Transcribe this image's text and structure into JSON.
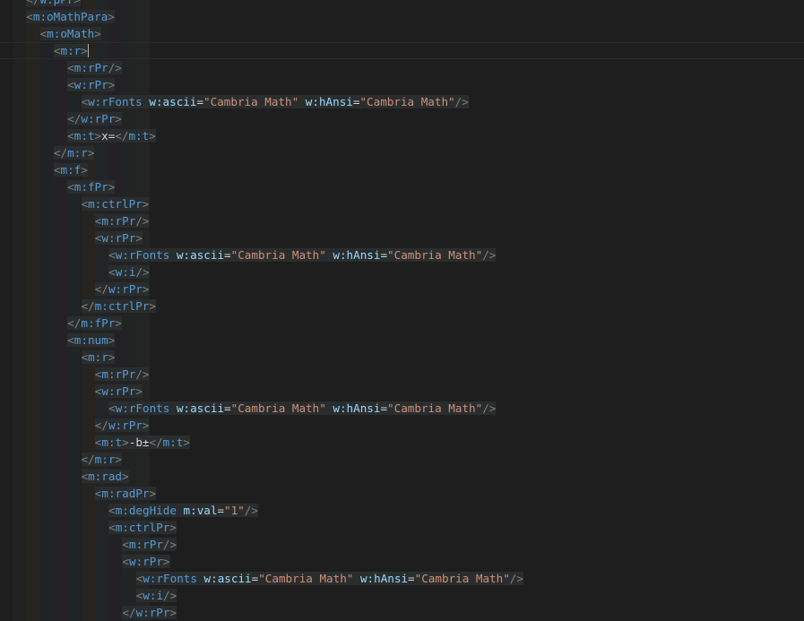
{
  "editor": {
    "theme_colors": {
      "background": "#1e1e1e",
      "tag": "#569cd6",
      "attribute": "#9cdcfe",
      "value": "#ce9178",
      "text": "#d4d4d4",
      "bracket": "#808080"
    },
    "lines": [
      {
        "indent": 1,
        "parts": [
          {
            "t": "b",
            "v": "</"
          },
          {
            "t": "tag",
            "v": "w:pPr"
          },
          {
            "t": "b",
            "v": ">"
          }
        ]
      },
      {
        "indent": 1,
        "parts": [
          {
            "t": "b",
            "v": "<"
          },
          {
            "t": "tag",
            "v": "m:oMathPara"
          },
          {
            "t": "b",
            "v": ">"
          }
        ]
      },
      {
        "indent": 2,
        "parts": [
          {
            "t": "b",
            "v": "<"
          },
          {
            "t": "tag",
            "v": "m:oMath"
          },
          {
            "t": "b",
            "v": ">"
          }
        ]
      },
      {
        "indent": 3,
        "current": true,
        "caret": true,
        "parts": [
          {
            "t": "b",
            "v": "<"
          },
          {
            "t": "tag",
            "v": "m:r"
          },
          {
            "t": "b",
            "v": ">"
          }
        ]
      },
      {
        "indent": 4,
        "parts": [
          {
            "t": "b",
            "v": "<"
          },
          {
            "t": "tag",
            "v": "m:rPr"
          },
          {
            "t": "b",
            "v": "/>"
          }
        ]
      },
      {
        "indent": 4,
        "parts": [
          {
            "t": "b",
            "v": "<"
          },
          {
            "t": "tag",
            "v": "w:rPr"
          },
          {
            "t": "b",
            "v": ">"
          }
        ]
      },
      {
        "indent": 5,
        "parts": [
          {
            "t": "b",
            "v": "<"
          },
          {
            "t": "tag",
            "v": "w:rFonts"
          },
          {
            "t": "s",
            "v": " "
          },
          {
            "t": "attr",
            "v": "w:ascii"
          },
          {
            "t": "eq",
            "v": "="
          },
          {
            "t": "val",
            "v": "\"Cambria Math\""
          },
          {
            "t": "s",
            "v": " "
          },
          {
            "t": "attr",
            "v": "w:hAnsi"
          },
          {
            "t": "eq",
            "v": "="
          },
          {
            "t": "val",
            "v": "\"Cambria Math\""
          },
          {
            "t": "b",
            "v": "/>"
          }
        ]
      },
      {
        "indent": 4,
        "parts": [
          {
            "t": "b",
            "v": "</"
          },
          {
            "t": "tag",
            "v": "w:rPr"
          },
          {
            "t": "b",
            "v": ">"
          }
        ]
      },
      {
        "indent": 4,
        "parts": [
          {
            "t": "b",
            "v": "<"
          },
          {
            "t": "tag",
            "v": "m:t"
          },
          {
            "t": "b",
            "v": ">"
          },
          {
            "t": "text",
            "v": "x="
          },
          {
            "t": "b",
            "v": "</"
          },
          {
            "t": "tag",
            "v": "m:t"
          },
          {
            "t": "b",
            "v": ">"
          }
        ]
      },
      {
        "indent": 3,
        "parts": [
          {
            "t": "b",
            "v": "</"
          },
          {
            "t": "tag",
            "v": "m:r"
          },
          {
            "t": "b",
            "v": ">"
          }
        ]
      },
      {
        "indent": 3,
        "parts": [
          {
            "t": "b",
            "v": "<"
          },
          {
            "t": "tag",
            "v": "m:f"
          },
          {
            "t": "b",
            "v": ">"
          }
        ]
      },
      {
        "indent": 4,
        "parts": [
          {
            "t": "b",
            "v": "<"
          },
          {
            "t": "tag",
            "v": "m:fPr"
          },
          {
            "t": "b",
            "v": ">"
          }
        ]
      },
      {
        "indent": 5,
        "parts": [
          {
            "t": "b",
            "v": "<"
          },
          {
            "t": "tag",
            "v": "m:ctrlPr"
          },
          {
            "t": "b",
            "v": ">"
          }
        ]
      },
      {
        "indent": 6,
        "parts": [
          {
            "t": "b",
            "v": "<"
          },
          {
            "t": "tag",
            "v": "m:rPr"
          },
          {
            "t": "b",
            "v": "/>"
          }
        ]
      },
      {
        "indent": 6,
        "parts": [
          {
            "t": "b",
            "v": "<"
          },
          {
            "t": "tag",
            "v": "w:rPr"
          },
          {
            "t": "b",
            "v": ">"
          }
        ]
      },
      {
        "indent": 7,
        "parts": [
          {
            "t": "b",
            "v": "<"
          },
          {
            "t": "tag",
            "v": "w:rFonts"
          },
          {
            "t": "s",
            "v": " "
          },
          {
            "t": "attr",
            "v": "w:ascii"
          },
          {
            "t": "eq",
            "v": "="
          },
          {
            "t": "val",
            "v": "\"Cambria Math\""
          },
          {
            "t": "s",
            "v": " "
          },
          {
            "t": "attr",
            "v": "w:hAnsi"
          },
          {
            "t": "eq",
            "v": "="
          },
          {
            "t": "val",
            "v": "\"Cambria Math\""
          },
          {
            "t": "b",
            "v": "/>"
          }
        ]
      },
      {
        "indent": 7,
        "parts": [
          {
            "t": "b",
            "v": "<"
          },
          {
            "t": "tag",
            "v": "w:i"
          },
          {
            "t": "b",
            "v": "/>"
          }
        ]
      },
      {
        "indent": 6,
        "parts": [
          {
            "t": "b",
            "v": "</"
          },
          {
            "t": "tag",
            "v": "w:rPr"
          },
          {
            "t": "b",
            "v": ">"
          }
        ]
      },
      {
        "indent": 5,
        "parts": [
          {
            "t": "b",
            "v": "</"
          },
          {
            "t": "tag",
            "v": "m:ctrlPr"
          },
          {
            "t": "b",
            "v": ">"
          }
        ]
      },
      {
        "indent": 4,
        "parts": [
          {
            "t": "b",
            "v": "</"
          },
          {
            "t": "tag",
            "v": "m:fPr"
          },
          {
            "t": "b",
            "v": ">"
          }
        ]
      },
      {
        "indent": 4,
        "parts": [
          {
            "t": "b",
            "v": "<"
          },
          {
            "t": "tag",
            "v": "m:num"
          },
          {
            "t": "b",
            "v": ">"
          }
        ]
      },
      {
        "indent": 5,
        "parts": [
          {
            "t": "b",
            "v": "<"
          },
          {
            "t": "tag",
            "v": "m:r"
          },
          {
            "t": "b",
            "v": ">"
          }
        ]
      },
      {
        "indent": 6,
        "parts": [
          {
            "t": "b",
            "v": "<"
          },
          {
            "t": "tag",
            "v": "m:rPr"
          },
          {
            "t": "b",
            "v": "/>"
          }
        ]
      },
      {
        "indent": 6,
        "parts": [
          {
            "t": "b",
            "v": "<"
          },
          {
            "t": "tag",
            "v": "w:rPr"
          },
          {
            "t": "b",
            "v": ">"
          }
        ]
      },
      {
        "indent": 7,
        "parts": [
          {
            "t": "b",
            "v": "<"
          },
          {
            "t": "tag",
            "v": "w:rFonts"
          },
          {
            "t": "s",
            "v": " "
          },
          {
            "t": "attr",
            "v": "w:ascii"
          },
          {
            "t": "eq",
            "v": "="
          },
          {
            "t": "val",
            "v": "\"Cambria Math\""
          },
          {
            "t": "s",
            "v": " "
          },
          {
            "t": "attr",
            "v": "w:hAnsi"
          },
          {
            "t": "eq",
            "v": "="
          },
          {
            "t": "val",
            "v": "\"Cambria Math\""
          },
          {
            "t": "b",
            "v": "/>"
          }
        ]
      },
      {
        "indent": 6,
        "parts": [
          {
            "t": "b",
            "v": "</"
          },
          {
            "t": "tag",
            "v": "w:rPr"
          },
          {
            "t": "b",
            "v": ">"
          }
        ]
      },
      {
        "indent": 6,
        "parts": [
          {
            "t": "b",
            "v": "<"
          },
          {
            "t": "tag",
            "v": "m:t"
          },
          {
            "t": "b",
            "v": ">"
          },
          {
            "t": "text",
            "v": "-b±"
          },
          {
            "t": "b",
            "v": "</"
          },
          {
            "t": "tag",
            "v": "m:t"
          },
          {
            "t": "b",
            "v": ">"
          }
        ]
      },
      {
        "indent": 5,
        "parts": [
          {
            "t": "b",
            "v": "</"
          },
          {
            "t": "tag",
            "v": "m:r"
          },
          {
            "t": "b",
            "v": ">"
          }
        ]
      },
      {
        "indent": 5,
        "parts": [
          {
            "t": "b",
            "v": "<"
          },
          {
            "t": "tag",
            "v": "m:rad"
          },
          {
            "t": "b",
            "v": ">"
          }
        ]
      },
      {
        "indent": 6,
        "parts": [
          {
            "t": "b",
            "v": "<"
          },
          {
            "t": "tag",
            "v": "m:radPr"
          },
          {
            "t": "b",
            "v": ">"
          }
        ]
      },
      {
        "indent": 7,
        "parts": [
          {
            "t": "b",
            "v": "<"
          },
          {
            "t": "tag",
            "v": "m:degHide"
          },
          {
            "t": "s",
            "v": " "
          },
          {
            "t": "attr",
            "v": "m:val"
          },
          {
            "t": "eq",
            "v": "="
          },
          {
            "t": "val",
            "v": "\"1\""
          },
          {
            "t": "b",
            "v": "/>"
          }
        ]
      },
      {
        "indent": 7,
        "parts": [
          {
            "t": "b",
            "v": "<"
          },
          {
            "t": "tag",
            "v": "m:ctrlPr"
          },
          {
            "t": "b",
            "v": ">"
          }
        ]
      },
      {
        "indent": 8,
        "parts": [
          {
            "t": "b",
            "v": "<"
          },
          {
            "t": "tag",
            "v": "m:rPr"
          },
          {
            "t": "b",
            "v": "/>"
          }
        ]
      },
      {
        "indent": 8,
        "parts": [
          {
            "t": "b",
            "v": "<"
          },
          {
            "t": "tag",
            "v": "w:rPr"
          },
          {
            "t": "b",
            "v": ">"
          }
        ]
      },
      {
        "indent": 9,
        "parts": [
          {
            "t": "b",
            "v": "<"
          },
          {
            "t": "tag",
            "v": "w:rFonts"
          },
          {
            "t": "s",
            "v": " "
          },
          {
            "t": "attr",
            "v": "w:ascii"
          },
          {
            "t": "eq",
            "v": "="
          },
          {
            "t": "val",
            "v": "\"Cambria Math\""
          },
          {
            "t": "s",
            "v": " "
          },
          {
            "t": "attr",
            "v": "w:hAnsi"
          },
          {
            "t": "eq",
            "v": "="
          },
          {
            "t": "val",
            "v": "\"Cambria Math\""
          },
          {
            "t": "b",
            "v": "/>"
          }
        ]
      },
      {
        "indent": 9,
        "parts": [
          {
            "t": "b",
            "v": "<"
          },
          {
            "t": "tag",
            "v": "w:i"
          },
          {
            "t": "b",
            "v": "/>"
          }
        ]
      },
      {
        "indent": 8,
        "parts": [
          {
            "t": "b",
            "v": "</"
          },
          {
            "t": "tag",
            "v": "w:rPr"
          },
          {
            "t": "b",
            "v": ">"
          }
        ]
      }
    ]
  }
}
